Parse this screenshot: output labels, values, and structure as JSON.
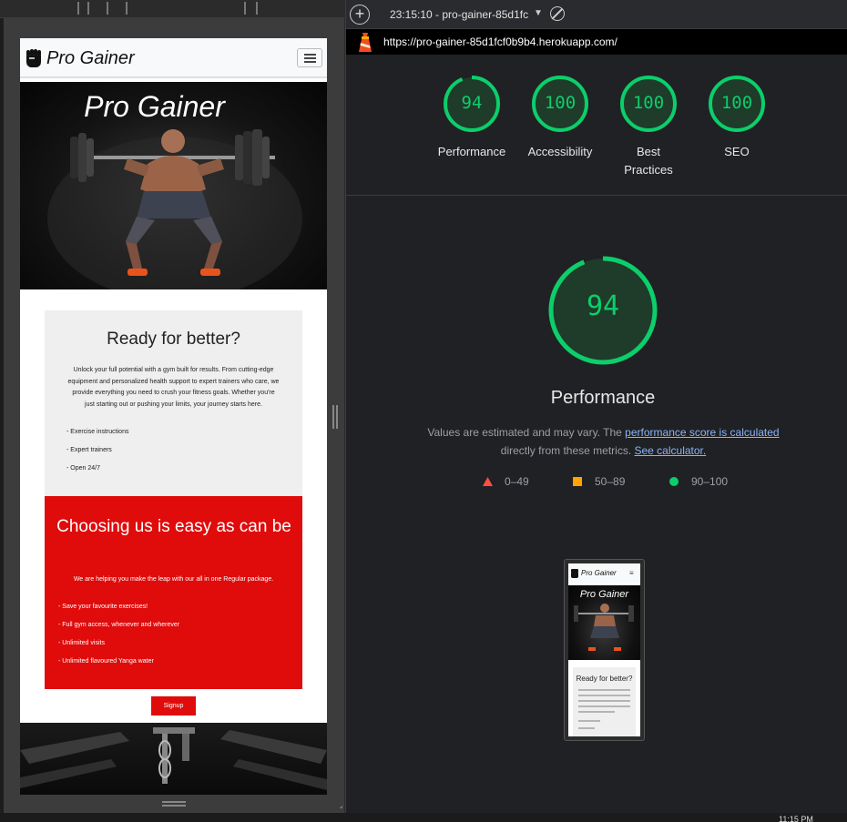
{
  "devtools": {
    "report_title": "23:15:10 - pro-gainer-85d1fc",
    "url": "https://pro-gainer-85d1fcf0b9b4.herokuapp.com/"
  },
  "site": {
    "brand": "Pro Gainer",
    "hero_title": "Pro Gainer",
    "panel1": {
      "title": "Ready for better?",
      "intro": "Unlock your full potential with a gym built for results. From cutting-edge equipment and personalized health support to expert trainers who care, we provide everything you need to crush your fitness goals. Whether you're just starting out or pushing your limits, your journey starts here.",
      "bullets": [
        "- Exercise instructions",
        "- Expert trainers",
        "- Open 24/7"
      ]
    },
    "panel2": {
      "title": "Choosing us is easy as can be",
      "intro": "We are helping you make the leap with our all in one Regular package.",
      "bullets": [
        "- Save your favourite exercises!",
        "- Full gym access, whenever and wherever",
        "- Unlimited visits",
        "- Unlimited flavoured Yanga water"
      ]
    },
    "signup_label": "Signup"
  },
  "lighthouse": {
    "scores": [
      {
        "label": "Performance",
        "value": 94
      },
      {
        "label": "Accessibility",
        "value": 100
      },
      {
        "label": "Best Practices",
        "value": 100
      },
      {
        "label": "SEO",
        "value": 100
      }
    ],
    "main": {
      "value": 94,
      "label": "Performance"
    },
    "desc_prefix": "Values are estimated and may vary. The ",
    "desc_link1": "performance score is calculated",
    "desc_mid": "directly from these metrics.",
    "desc_link2": "See calculator.",
    "legend": [
      "0–49",
      "50–89",
      "90–100"
    ],
    "thumb": {
      "brand": "Pro Gainer",
      "hero_title": "Pro Gainer",
      "panel_title": "Ready for better?"
    },
    "colors": {
      "pass": "#0cce6b",
      "average": "#ffa400",
      "fail": "#ff4e42"
    }
  },
  "taskbar": {
    "clock": "11:15 PM"
  }
}
